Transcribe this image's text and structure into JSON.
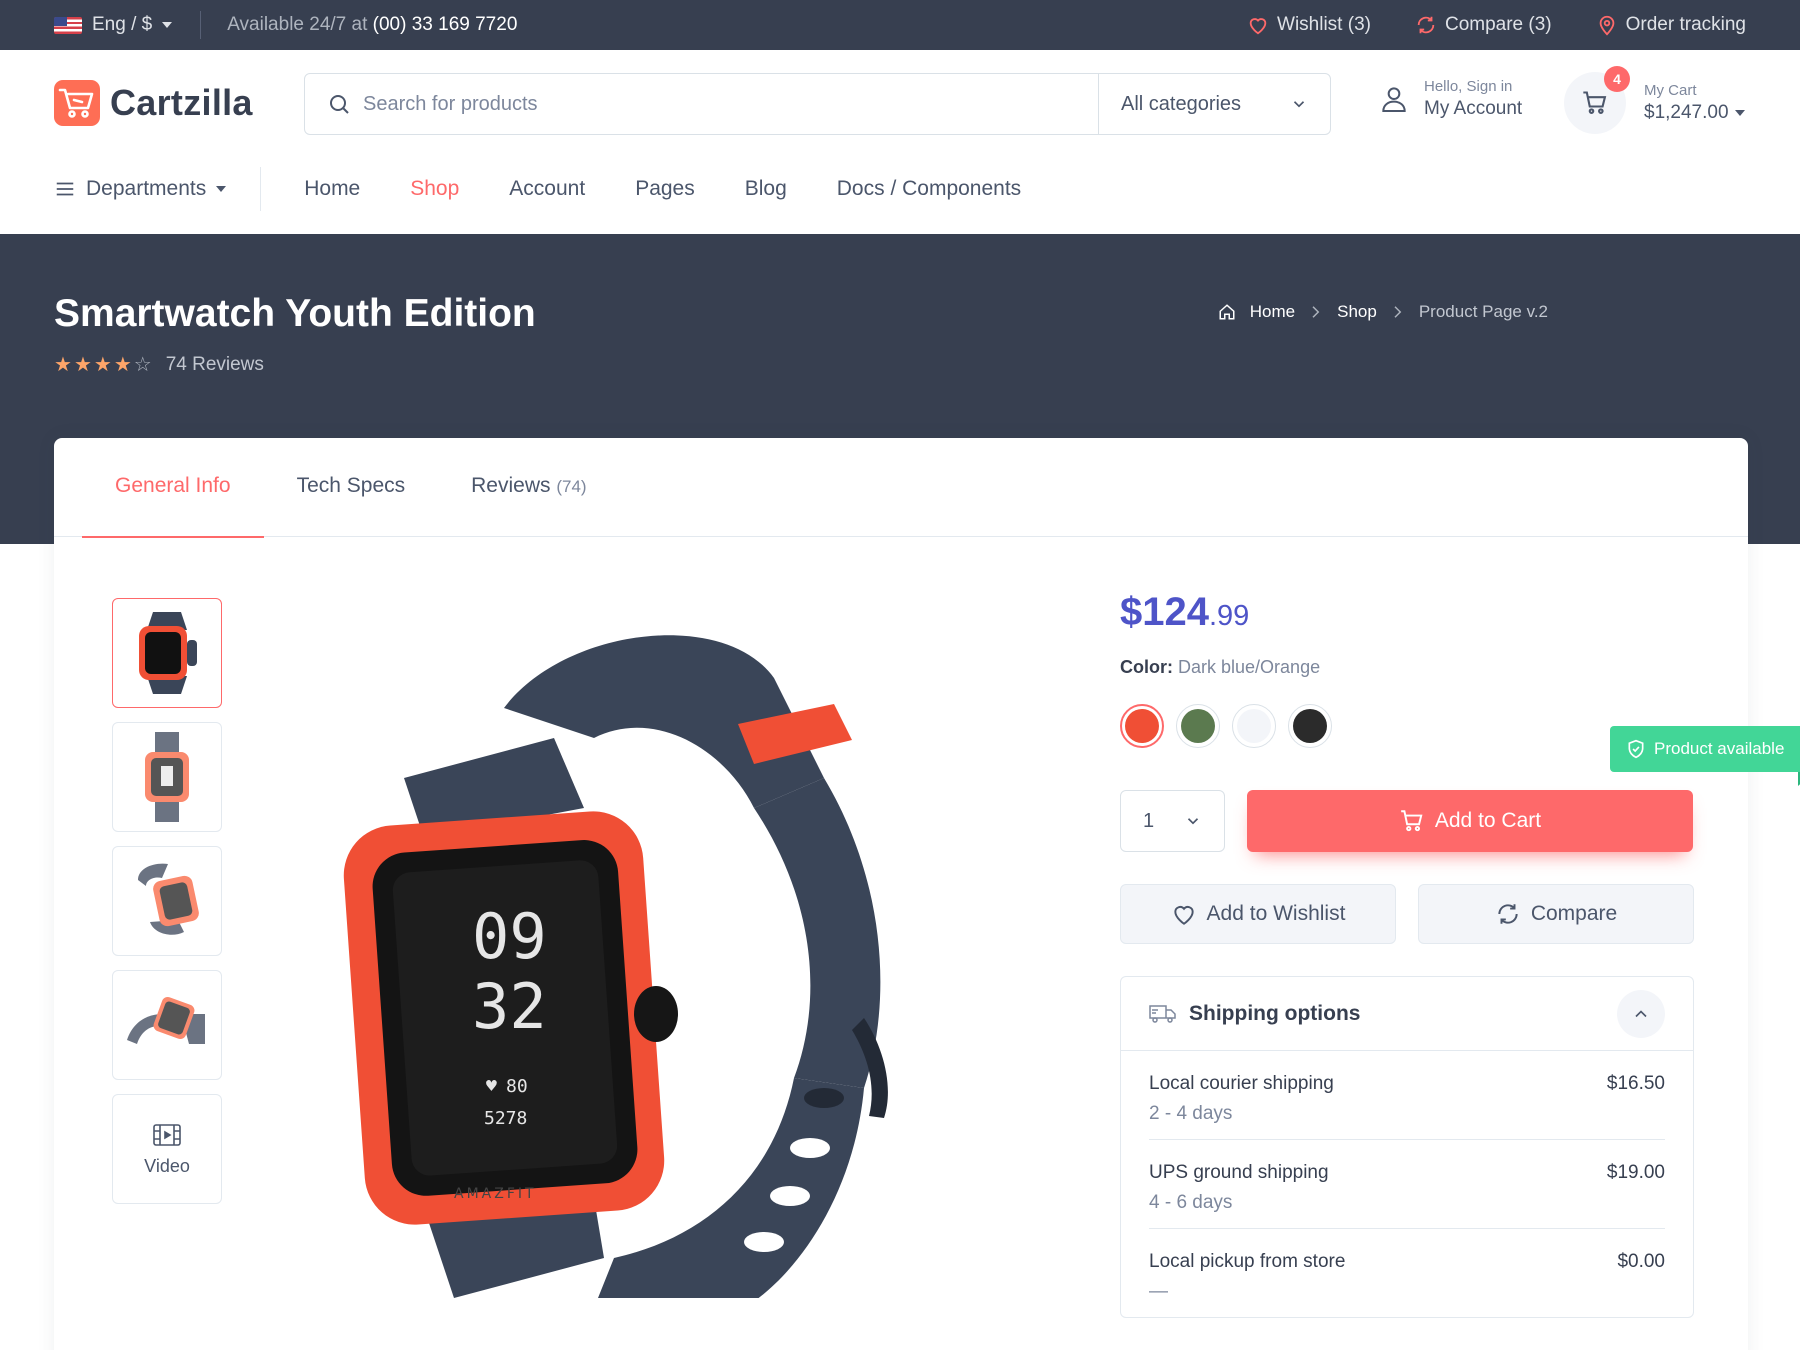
{
  "topbar": {
    "lang": "Eng / $",
    "available_prefix": "Available 24/7 at",
    "phone": "(00) 33 169 7720",
    "wishlist": "Wishlist (3)",
    "compare": "Compare (3)",
    "order_tracking": "Order tracking"
  },
  "header": {
    "logo": "Cartzilla",
    "search_placeholder": "Search for products",
    "category": "All categories",
    "account_small": "Hello, Sign in",
    "account_big": "My Account",
    "cart_small": "My Cart",
    "cart_total": "$1,247.00",
    "cart_count": "4"
  },
  "nav": {
    "departments": "Departments",
    "links": [
      "Home",
      "Shop",
      "Account",
      "Pages",
      "Blog",
      "Docs / Components"
    ],
    "active": "Shop"
  },
  "hero": {
    "title": "Smartwatch Youth Edition",
    "rating": 4,
    "rating_max": 5,
    "reviews": "74 Reviews",
    "breadcrumb": [
      "Home",
      "Shop",
      "Product Page v.2"
    ]
  },
  "tabs": {
    "general": "General Info",
    "specs": "Tech Specs",
    "reviews": "Reviews",
    "reviews_count": "(74)"
  },
  "gallery": {
    "video_label": "Video",
    "watch_time_h": "09",
    "watch_time_m": "32",
    "watch_heart": "80",
    "watch_steps": "5278",
    "watch_brand": "AMAZFIT"
  },
  "product": {
    "price_main": "$124",
    "price_cents": ".99",
    "color_label": "Color:",
    "color_value": "Dark blue/Orange",
    "swatch_colors": [
      "#f04f35",
      "#5b7a4f",
      "#f3f5f9",
      "#2b2b2b"
    ],
    "availability": "Product available",
    "qty": "1",
    "add_to_cart": "Add to Cart",
    "add_to_wishlist": "Add to Wishlist",
    "compare": "Compare"
  },
  "shipping": {
    "title": "Shipping options",
    "options": [
      {
        "name": "Local courier shipping",
        "time": "2 - 4 days",
        "price": "$16.50"
      },
      {
        "name": "UPS ground shipping",
        "time": "4 - 6 days",
        "price": "$19.00"
      },
      {
        "name": "Local pickup from store",
        "time": "—",
        "price": "$0.00"
      }
    ]
  },
  "colors": {
    "accent": "#fe696a",
    "dark": "#373f50",
    "price": "#4e54c8",
    "success": "#42d697"
  }
}
